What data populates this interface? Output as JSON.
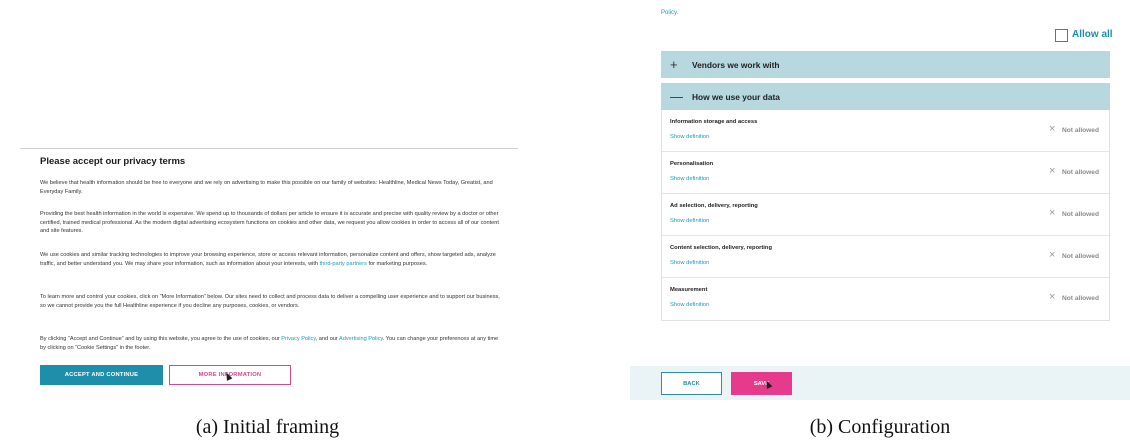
{
  "panel_a": {
    "title": "Please accept our privacy terms",
    "para1": "We believe that health information should be free to everyone and we rely on advertising to make this possible on our family of websites: Healthline, Medical News Today, Greatist, and Everyday Family.",
    "para2": "Providing the best health information in the world is expensive. We spend up to thousands of dollars per article to ensure it is accurate and precise with quality review by a doctor or other certified, trained medical professional. As the modern digital advertising ecosystem functions on cookies and other data, we request you allow cookies in order to access all of our content and site features.",
    "para3_before": "We use cookies and similar tracking technologies to improve your browsing experience, store or access relevant information, personalize content and offers, show targeted ads, analyze traffic, and better understand you. We may share your information, such as information about your interests, with ",
    "para3_link": "third-party partners",
    "para3_after": " for marketing purposes.",
    "para4": "To learn more and control your cookies, click on “More Information” below. Our sites need to collect and process data to deliver a compelling user experience and to support our business, so we cannot provide you the full Healthline experience if you decline any purposes, cookies, or vendors.",
    "para5_before": "By clicking “Accept and Continue” and by using this website, you agree to the use of cookies, our ",
    "para5_link1": "Privacy Policy",
    "para5_mid": ", and our ",
    "para5_link2": "Advertising Policy",
    "para5_after": ". You can change your preferences at any time by clicking on “Cookie Settings” in the footer.",
    "accept_label": "ACCEPT AND CONTINUE",
    "more_label": "MORE INFORMATION",
    "caption": "(a) Initial framing"
  },
  "panel_b": {
    "policy_text": "Policy.",
    "allow_all_label": "Allow all",
    "vendors_sign": "+",
    "vendors_label": "Vendors we work with",
    "usage_sign": "—",
    "usage_label": "How we use your data",
    "purposes": [
      {
        "title": "Information storage and access",
        "definition": "Show definition",
        "icon": "×",
        "status": "Not allowed"
      },
      {
        "title": "Personalisation",
        "definition": "Show definition",
        "icon": "×",
        "status": "Not allowed"
      },
      {
        "title": "Ad selection, delivery, reporting",
        "definition": "Show definition",
        "icon": "×",
        "status": "Not allowed"
      },
      {
        "title": "Content selection, delivery, reporting",
        "definition": "Show definition",
        "icon": "×",
        "status": "Not allowed"
      },
      {
        "title": "Measurement",
        "definition": "Show definition",
        "icon": "×",
        "status": "Not allowed"
      }
    ],
    "back_label": "BACK",
    "save_label": "SAVE",
    "caption": "(b) Configuration"
  },
  "colors": {
    "accent_teal": "#1d8fab",
    "link_teal": "#1a9bb8",
    "section_bar": "#b7d8df",
    "save_pink": "#e63a8d",
    "more_info_pink": "#d9468b",
    "footer_bg": "#eaf3f5"
  }
}
